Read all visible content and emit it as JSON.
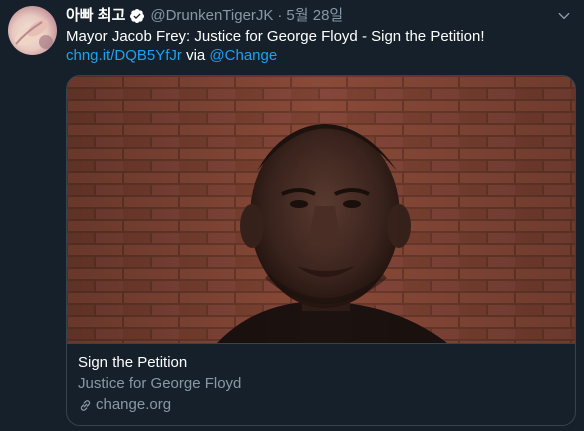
{
  "tweet": {
    "display_name": "아빠 최고",
    "handle": "@DrunkenTigerJK",
    "separator": "·",
    "date": "5월 28일",
    "text": "Mayor Jacob Frey: Justice for George Floyd - Sign the Petition!",
    "short_link": "chng.it/DQB5YfJr",
    "via_label": "via",
    "via_mention": "@Change"
  },
  "card": {
    "title": "Sign the Petition",
    "subtitle": "Justice for George Floyd",
    "domain": "change.org"
  },
  "icons": {
    "verified": "verified-badge-icon",
    "more": "chevron-down-icon",
    "link": "link-icon"
  },
  "colors": {
    "background": "#15202b",
    "link": "#1da1f2",
    "secondary_text": "#8899a6",
    "border": "#38444d"
  }
}
